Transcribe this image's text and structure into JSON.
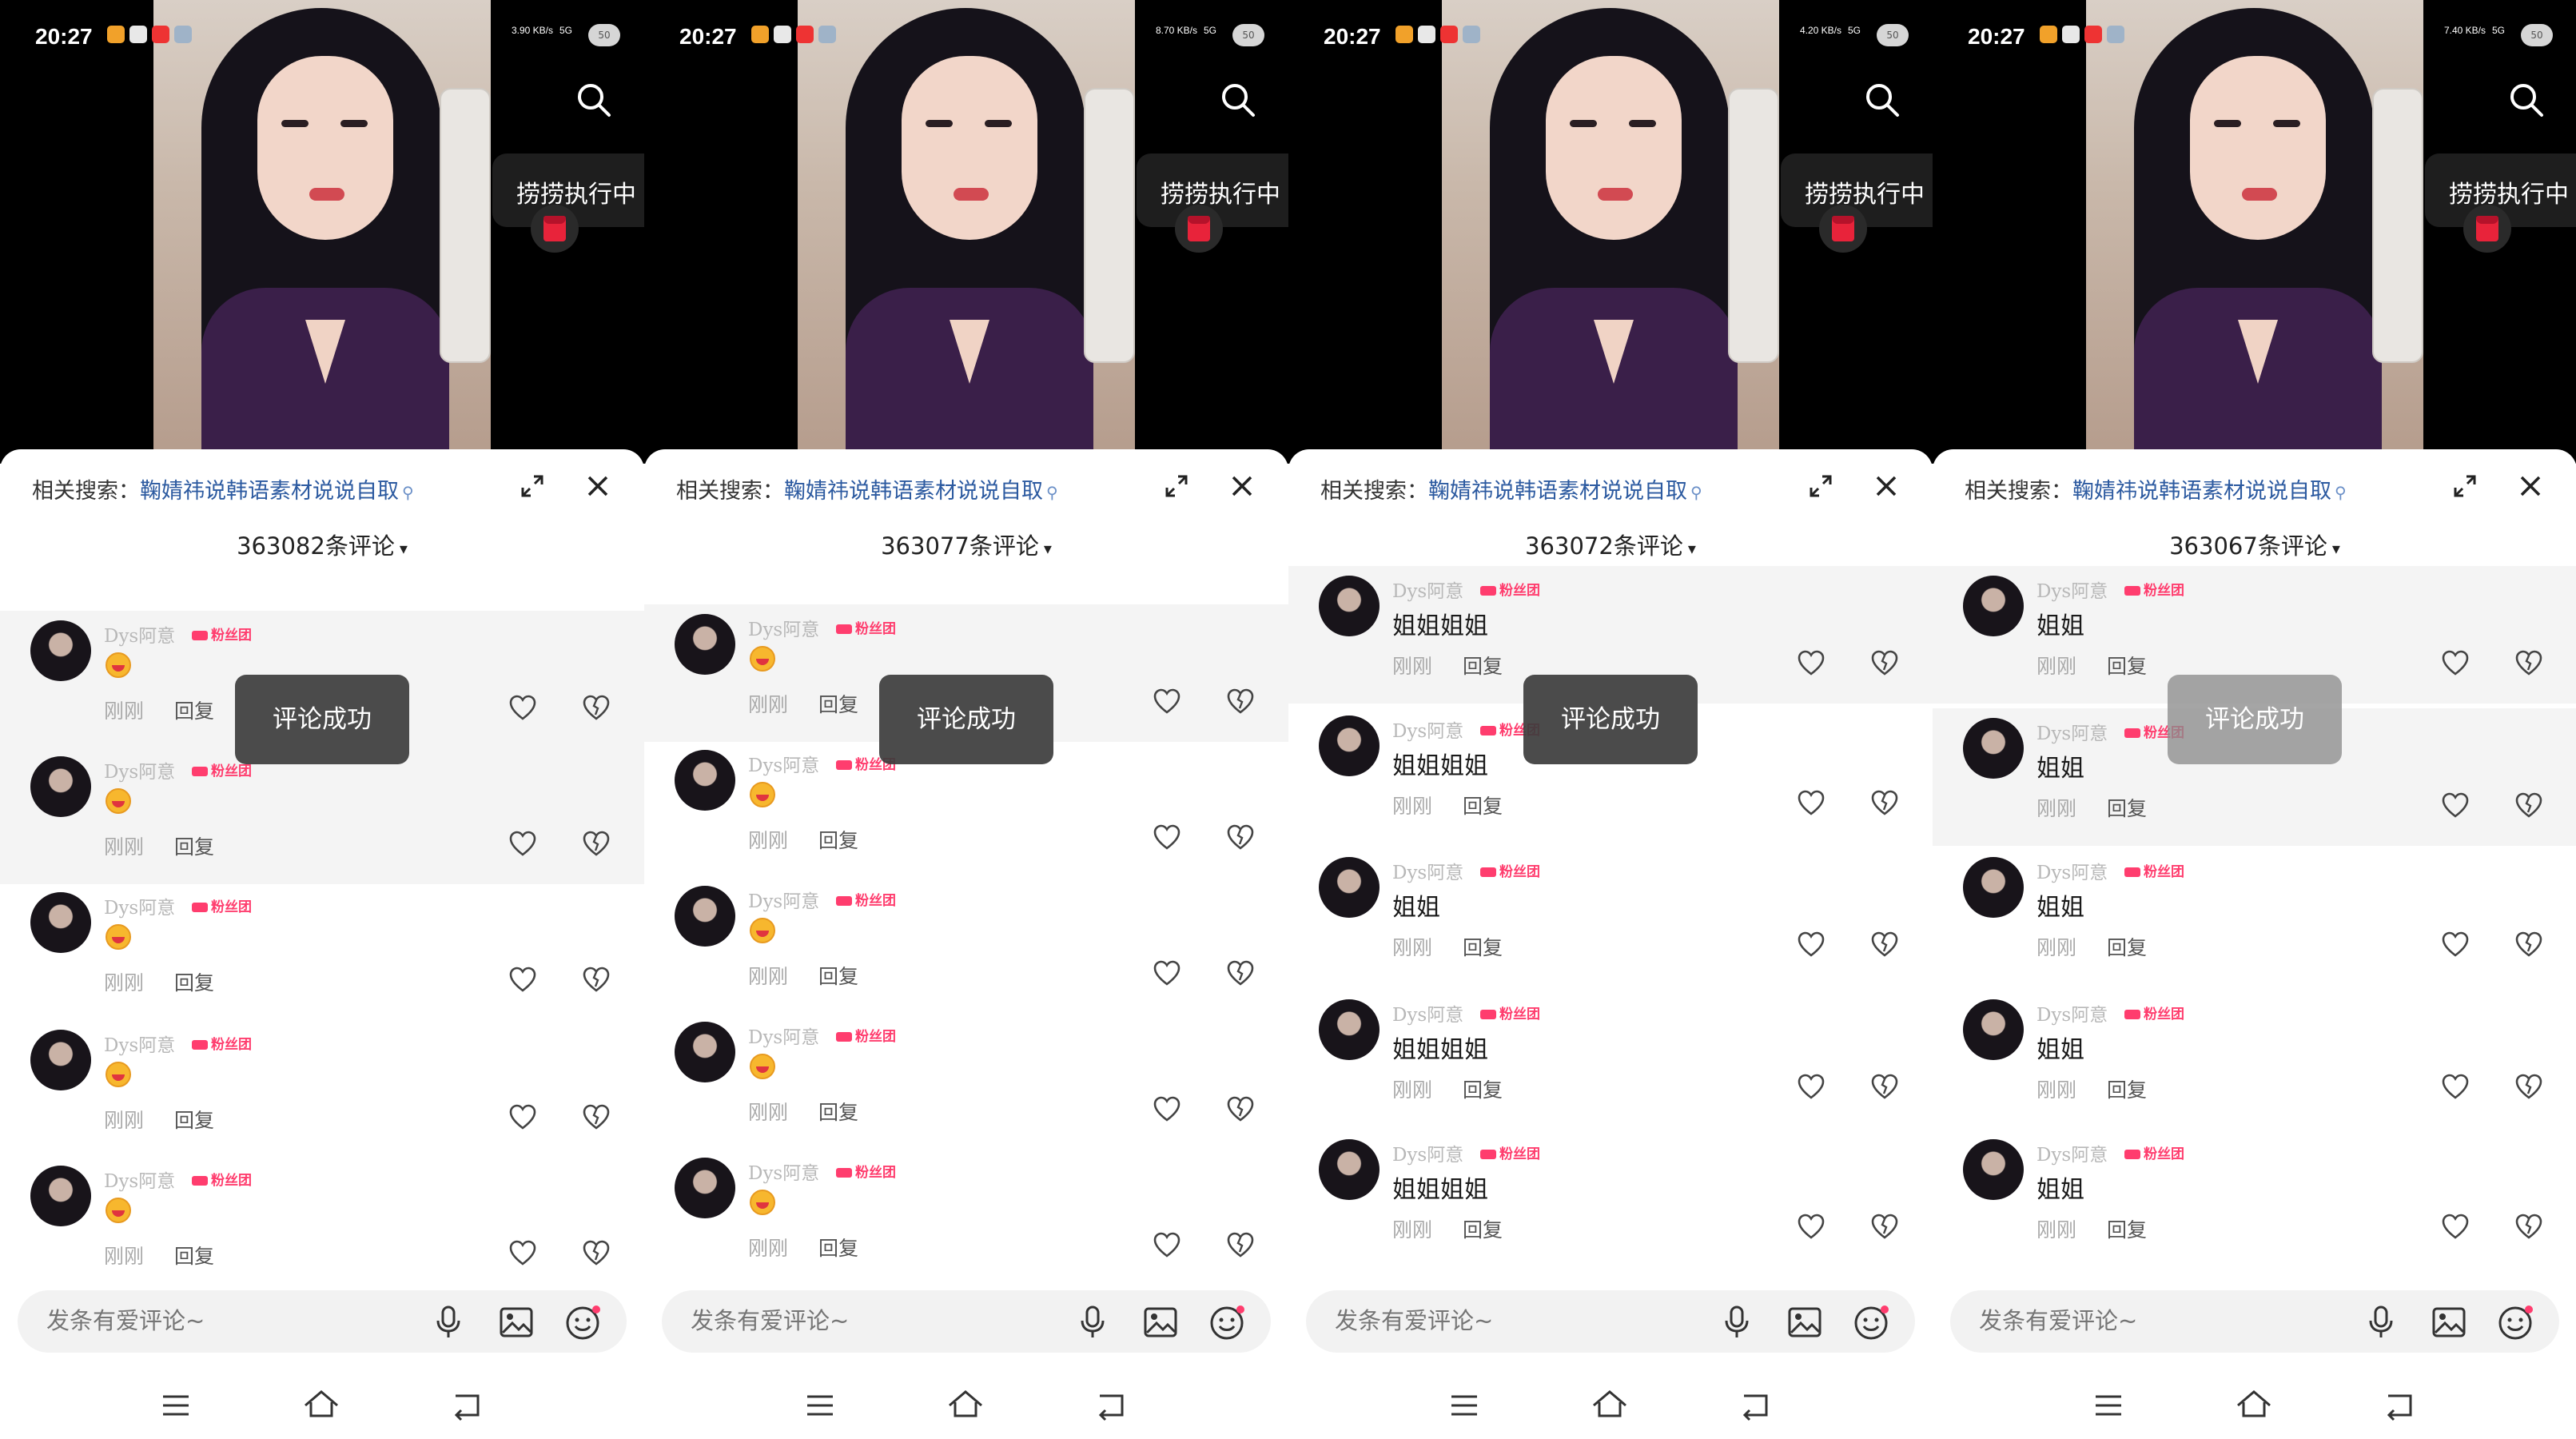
{
  "panels": [
    {
      "status": {
        "time": "20:27",
        "net": "3.90 KB/s",
        "signal": "5G",
        "battery": "50"
      },
      "live_label": "捞捞执行中",
      "related_prefix": "相关搜索：",
      "related_keyword": "鞠婧祎说韩语素材说说自取",
      "comment_count": "363082条评论",
      "toast": "评论成功",
      "input_placeholder": "发条有爱评论~",
      "comments": [
        {
          "user": "Dys阿意",
          "badge": "粉丝团",
          "text": "",
          "time": "刚刚",
          "reply": "回复"
        },
        {
          "user": "Dys阿意",
          "badge": "粉丝团",
          "text": "",
          "time": "刚刚",
          "reply": "回复"
        },
        {
          "user": "Dys阿意",
          "badge": "粉丝团",
          "text": "",
          "time": "刚刚",
          "reply": "回复"
        },
        {
          "user": "Dys阿意",
          "badge": "粉丝团",
          "text": "",
          "time": "刚刚",
          "reply": "回复"
        },
        {
          "user": "Dys阿意",
          "badge": "粉丝团",
          "text": "",
          "time": "刚刚",
          "reply": "回复"
        }
      ]
    },
    {
      "status": {
        "time": "20:27",
        "net": "8.70 KB/s",
        "signal": "5G",
        "battery": "50"
      },
      "live_label": "捞捞执行中",
      "related_prefix": "相关搜索：",
      "related_keyword": "鞠婧祎说韩语素材说说自取",
      "comment_count": "363077条评论",
      "toast": "评论成功",
      "input_placeholder": "发条有爱评论~",
      "comments": [
        {
          "user": "Dys阿意",
          "badge": "粉丝团",
          "text": "",
          "time": "刚刚",
          "reply": "回复"
        },
        {
          "user": "Dys阿意",
          "badge": "粉丝团",
          "text": "",
          "time": "刚刚",
          "reply": "回复"
        },
        {
          "user": "Dys阿意",
          "badge": "粉丝团",
          "text": "",
          "time": "刚刚",
          "reply": "回复"
        },
        {
          "user": "Dys阿意",
          "badge": "粉丝团",
          "text": "",
          "time": "刚刚",
          "reply": "回复"
        },
        {
          "user": "Dys阿意",
          "badge": "粉丝团",
          "text": "",
          "time": "刚刚",
          "reply": "回复"
        }
      ]
    },
    {
      "status": {
        "time": "20:27",
        "net": "4.20 KB/s",
        "signal": "5G",
        "battery": "50"
      },
      "live_label": "捞捞执行中",
      "related_prefix": "相关搜索：",
      "related_keyword": "鞠婧祎说韩语素材说说自取",
      "comment_count": "363072条评论",
      "toast": "评论成功",
      "input_placeholder": "发条有爱评论~",
      "comments": [
        {
          "user": "Dys阿意",
          "badge": "粉丝团",
          "text": "姐姐姐姐",
          "time": "刚刚",
          "reply": "回复"
        },
        {
          "user": "Dys阿意",
          "badge": "粉丝团",
          "text": "姐姐姐姐",
          "time": "刚刚",
          "reply": "回复"
        },
        {
          "user": "Dys阿意",
          "badge": "粉丝团",
          "text": "姐姐",
          "time": "刚刚",
          "reply": "回复"
        },
        {
          "user": "Dys阿意",
          "badge": "粉丝团",
          "text": "姐姐姐姐",
          "time": "刚刚",
          "reply": "回复"
        },
        {
          "user": "Dys阿意",
          "badge": "粉丝团",
          "text": "姐姐姐姐",
          "time": "刚刚",
          "reply": "回复"
        }
      ]
    },
    {
      "status": {
        "time": "20:27",
        "net": "7.40 KB/s",
        "signal": "5G",
        "battery": "50"
      },
      "live_label": "捞捞执行中",
      "related_prefix": "相关搜索：",
      "related_keyword": "鞠婧祎说韩语素材说说自取",
      "comment_count": "363067条评论",
      "toast": "评论成功",
      "input_placeholder": "发条有爱评论~",
      "comments": [
        {
          "user": "Dys阿意",
          "badge": "粉丝团",
          "text": "姐姐",
          "time": "刚刚",
          "reply": "回复"
        },
        {
          "user": "Dys阿意",
          "badge": "粉丝团",
          "text": "姐姐",
          "time": "刚刚",
          "reply": "回复"
        },
        {
          "user": "Dys阿意",
          "badge": "粉丝团",
          "text": "姐姐",
          "time": "刚刚",
          "reply": "回复"
        },
        {
          "user": "Dys阿意",
          "badge": "粉丝团",
          "text": "姐姐",
          "time": "刚刚",
          "reply": "回复"
        },
        {
          "user": "Dys阿意",
          "badge": "粉丝团",
          "text": "姐姐",
          "time": "刚刚",
          "reply": "回复"
        }
      ]
    }
  ],
  "icons": {
    "search": "search-icon",
    "expand": "expand-icon",
    "close": "close-icon",
    "heart": "heart-icon",
    "dislike": "dislike-icon",
    "mic": "mic-icon",
    "image": "image-icon",
    "emoji": "emoji-icon",
    "menu": "nav-menu-icon",
    "home": "nav-home-icon",
    "back": "nav-back-icon",
    "red_packet": "red-packet-icon"
  },
  "colors": {
    "accent": "#ff3d6e",
    "keyword": "#2c5aa0",
    "toast_bg": "#3c3c3c",
    "highlight_row": "#f4f4f4"
  }
}
